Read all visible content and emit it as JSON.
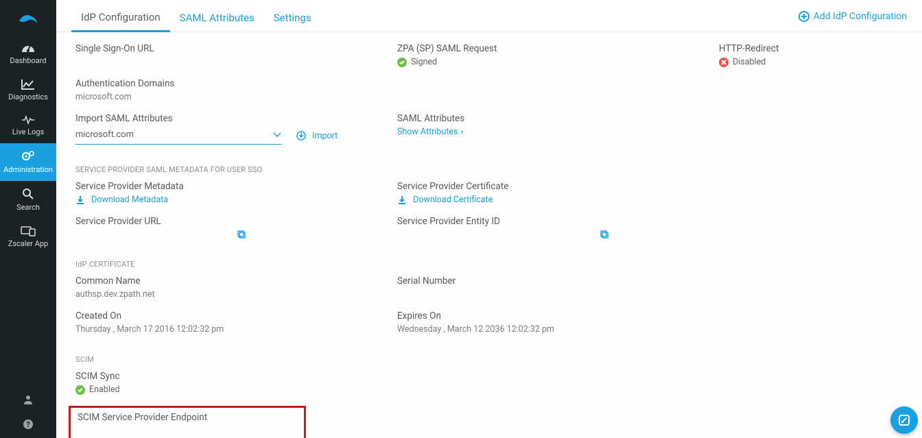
{
  "sidebar": {
    "items": [
      {
        "label": "Dashboard"
      },
      {
        "label": "Diagnostics"
      },
      {
        "label": "Live Logs"
      },
      {
        "label": "Administration"
      },
      {
        "label": "Search"
      },
      {
        "label": "Zscaler App"
      }
    ]
  },
  "tabs": {
    "idp_config": "IdP Configuration",
    "saml_attributes": "SAML Attributes",
    "settings": "Settings",
    "add_label": "Add IdP Configuration"
  },
  "sso": {
    "url_label": "Single Sign-On URL",
    "saml_request_label": "ZPA (SP) SAML Request",
    "saml_request_status": "Signed",
    "http_redirect_label": "HTTP-Redirect",
    "http_redirect_status": "Disabled",
    "auth_domains_label": "Authentication Domains",
    "auth_domains_value": "microsoft.com",
    "import_label": "Import SAML Attributes",
    "import_select_value": "microsoft.com",
    "import_action": "Import",
    "saml_attr_label": "SAML Attributes",
    "show_attributes": "Show Attributes"
  },
  "sp": {
    "header": "SERVICE PROVIDER SAML METADATA FOR USER SSO",
    "metadata_label": "Service Provider Metadata",
    "download_metadata": "Download Metadata",
    "cert_label": "Service Provider Certificate",
    "download_cert": "Download Certificate",
    "url_label": "Service Provider URL",
    "entity_label": "Service Provider Entity ID"
  },
  "idp_cert": {
    "header": "IdP CERTIFICATE",
    "common_name_label": "Common Name",
    "common_name_value": "authsp.dev.zpath.net",
    "serial_label": "Serial Number",
    "created_label": "Created On",
    "created_value": "Thursday , March 17 2016 12:02:32 pm",
    "expires_label": "Expires On",
    "expires_value": "Wednesday , March 12 2036 12:02:32 pm"
  },
  "scim": {
    "header": "SCIM",
    "sync_label": "SCIM Sync",
    "sync_status": "Enabled",
    "endpoint_label": "SCIM Service Provider Endpoint"
  }
}
